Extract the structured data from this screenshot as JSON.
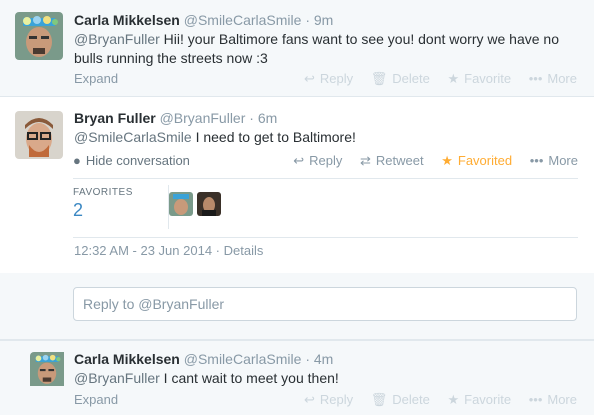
{
  "tweet1": {
    "name": "Carla Mikkelsen",
    "handle": "@SmileCarlaSmile",
    "time": "9m",
    "text_mention": "@BryanFuller",
    "text_line1": " Hii! your Baltimore fans want to see you! dont worry we have no",
    "text_line2": "bulls running the streets now :3",
    "expand": "Expand",
    "actions": {
      "reply": "Reply",
      "delete": "Delete",
      "favorite": "Favorite",
      "more": "More"
    }
  },
  "tweet2": {
    "name": "Bryan Fuller",
    "handle": "@BryanFuller",
    "time": "6m",
    "text_mention": "@SmileCarlaSmile",
    "text_rest": " I need to get to Baltimore!",
    "hide": "Hide conversation",
    "actions": {
      "reply": "Reply",
      "retweet": "Retweet",
      "favorited": "Favorited",
      "more": "More"
    },
    "stats": {
      "label": "FAVORITES",
      "value": "2"
    },
    "timestamp": "12:32 AM - 23 Jun 2014",
    "details": "Details",
    "reply_placeholder": "Reply to @BryanFuller"
  },
  "tweet3": {
    "name": "Carla Mikkelsen",
    "handle": "@SmileCarlaSmile",
    "time": "4m",
    "text_mention": "@BryanFuller",
    "text_rest": " I cant wait to meet you then!",
    "expand": "Expand",
    "actions": {
      "reply": "Reply",
      "delete": "Delete",
      "favorite": "Favorite",
      "more": "More"
    }
  },
  "colors": {
    "link": "#3b88c3",
    "favorited": "#ffac33",
    "muted": "#8899a6"
  },
  "icons": [
    "reply-icon",
    "delete-icon",
    "star-icon",
    "more-icon",
    "retweet-icon",
    "speech-bubble-icon"
  ]
}
